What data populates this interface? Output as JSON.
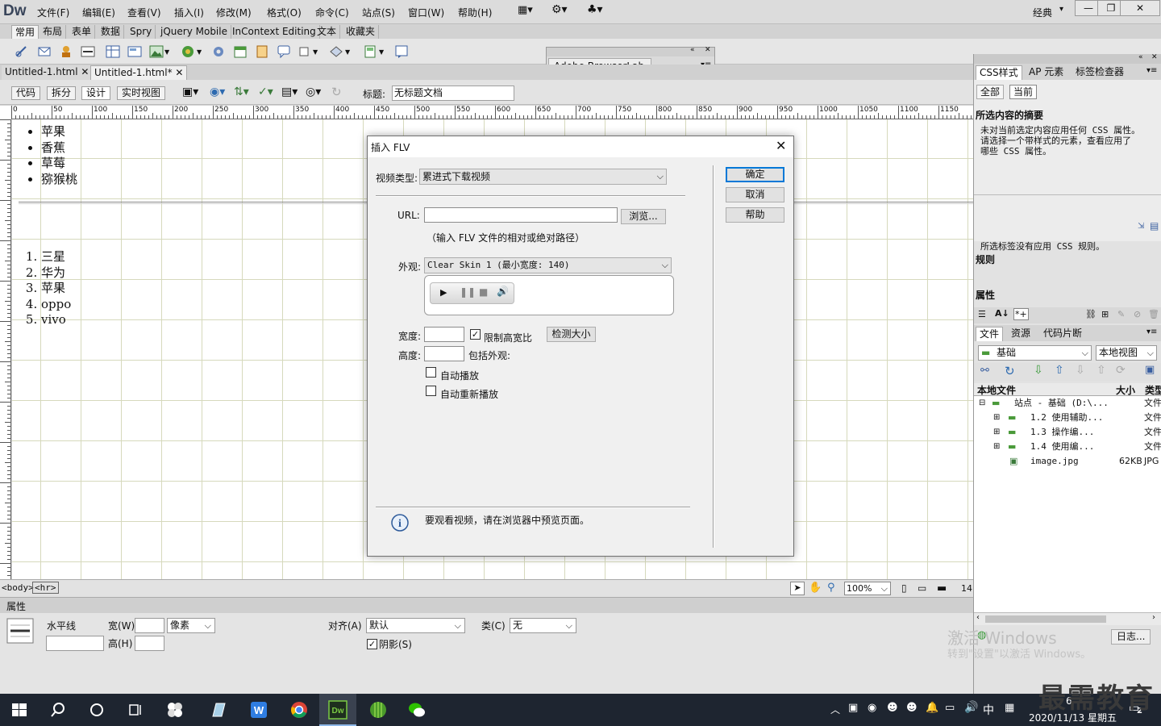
{
  "app": {
    "logo": "Dw",
    "workspace": "经典"
  },
  "menu": [
    "文件(F)",
    "编辑(E)",
    "查看(V)",
    "插入(I)",
    "修改(M)",
    "格式(O)",
    "命令(C)",
    "站点(S)",
    "窗口(W)",
    "帮助(H)"
  ],
  "insert_tabs": [
    "常用",
    "布局",
    "表单",
    "数据",
    "Spry",
    "jQuery Mobile",
    "InContext Editing",
    "文本",
    "收藏夹"
  ],
  "browserlab": {
    "title": "Adobe BrowserLab"
  },
  "doc_tabs": [
    "Untitled-1.html",
    "Untitled-1.html*"
  ],
  "doc_toolbar": {
    "code": "代码",
    "split": "拆分",
    "design": "设计",
    "live": "实时视图",
    "title_label": "标题:",
    "title_value": "无标题文档"
  },
  "ruler_h": [
    "0",
    "50",
    "100",
    "150",
    "200",
    "250",
    "300",
    "350",
    "400",
    "450",
    "500",
    "550",
    "600",
    "650",
    "700",
    "750",
    "800",
    "850",
    "900",
    "950",
    "1000",
    "1050",
    "1100",
    "1150"
  ],
  "content": {
    "ul": [
      "苹果",
      "香蕉",
      "草莓",
      "猕猴桃"
    ],
    "ol": [
      "三星",
      "华为",
      "苹果",
      "oppo",
      "vivo"
    ]
  },
  "statusbar": {
    "tags": [
      "<body>",
      "<hr>"
    ],
    "zoom": "100%",
    "size": "14"
  },
  "properties": {
    "header": "属性",
    "element": "水平线",
    "width_label": "宽(W)",
    "unit": "像素",
    "height_label": "高(H)",
    "align_label": "对齐(A)",
    "align_value": "默认",
    "class_label": "类(C)",
    "class_value": "无",
    "shade_label": "阴影(S)"
  },
  "right_panel": {
    "css_tabs": [
      "CSS样式",
      "AP 元素",
      "标签检查器"
    ],
    "mode_tabs": [
      "全部",
      "当前"
    ],
    "summary_title": "所选内容的摘要",
    "summary_text": [
      "未对当前选定内容应用任何 CSS 属性。",
      "请选择一个带样式的元素，查看应用了",
      "哪些 CSS 属性。"
    ],
    "rules_title": "规则",
    "rules_text": "所选标签没有应用 CSS 规则。",
    "props_title": "属性",
    "file_tabs": [
      "文件",
      "资源",
      "代码片断"
    ],
    "site": "基础",
    "view": "本地视图",
    "col_local": "本地文件",
    "col_size": "大小",
    "col_type": "类型",
    "tree": [
      {
        "name": "站点 - 基础 (D:\\...",
        "size": "",
        "type": "文件"
      },
      {
        "name": "1.2 使用辅助...",
        "size": "",
        "type": "文件"
      },
      {
        "name": "1.3  操作编...",
        "size": "",
        "type": "文件"
      },
      {
        "name": "1.4  使用编...",
        "size": "",
        "type": "文件"
      },
      {
        "name": "image.jpg",
        "size": "62KB",
        "type": "JPG"
      }
    ],
    "log_button": "日志..."
  },
  "dialog": {
    "title": "插入 FLV",
    "video_type_label": "视频类型:",
    "video_type_value": "累进式下载视频",
    "url_label": "URL:",
    "browse": "浏览...",
    "url_hint": "（输入 FLV 文件的相对或绝对路径）",
    "skin_label": "外观:",
    "skin_value": "Clear Skin 1 (最小宽度: 140)",
    "width_label": "宽度:",
    "constrain_label": "限制高宽比",
    "detect_size": "检测大小",
    "height_label": "高度:",
    "include_skin": "包括外观:",
    "autoplay": "自动播放",
    "autorewind": "自动重新播放",
    "info": "要观看视频，请在浏览器中预览页面。",
    "ok": "确定",
    "cancel": "取消",
    "help": "帮助"
  },
  "watermark": {
    "line1": "激活 Windows",
    "line2": "转到\"设置\"以激活 Windows。"
  },
  "brand": "最需教育",
  "taskbar": {
    "ime": "中",
    "time_partial": "6",
    "date": "2020/11/13 星期五",
    "notif_count": "2"
  },
  "colors": {
    "taskbar": "#1e2530",
    "accent": "#0078d7",
    "grid": "#d6d9bc"
  }
}
